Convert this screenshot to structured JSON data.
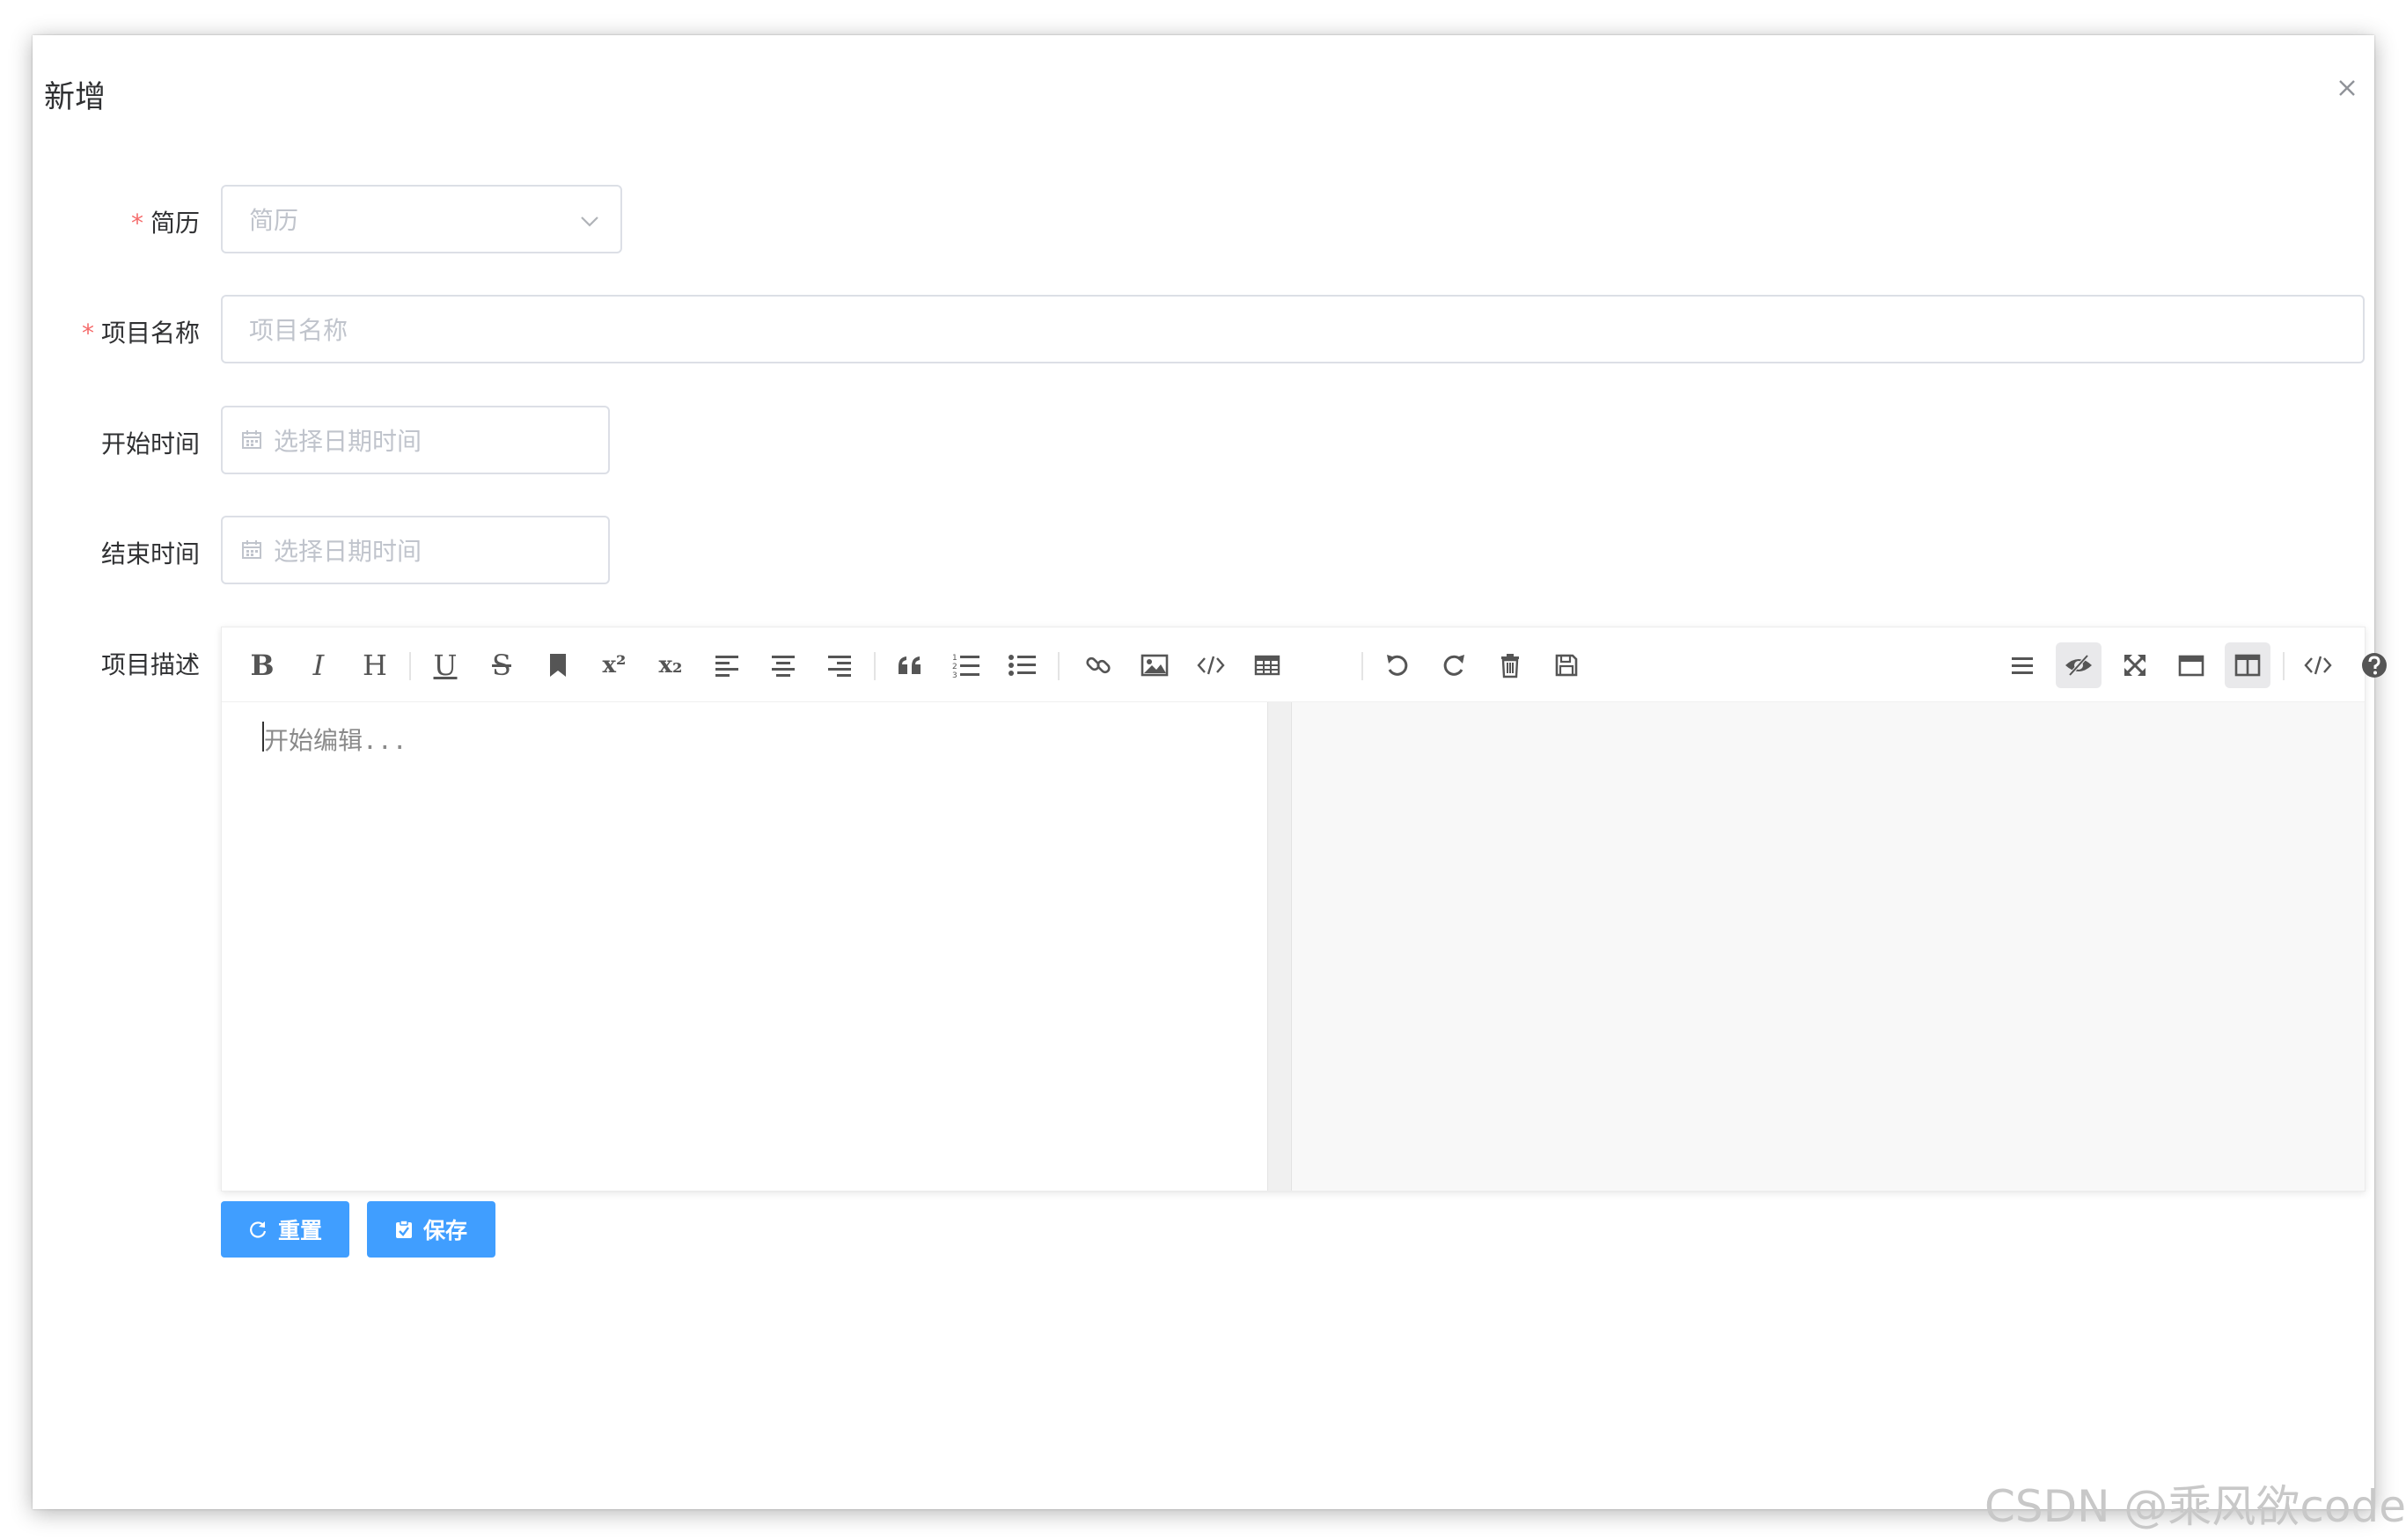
{
  "dialog": {
    "title": "新增",
    "close_icon": "close-icon"
  },
  "form": {
    "resume": {
      "required_mark": "*",
      "label": "简历",
      "placeholder": "简历"
    },
    "project_name": {
      "required_mark": "*",
      "label": "项目名称",
      "placeholder": "项目名称"
    },
    "start_time": {
      "label": "开始时间",
      "placeholder": "选择日期时间"
    },
    "end_time": {
      "label": "结束时间",
      "placeholder": "选择日期时间"
    },
    "description": {
      "label": "项目描述",
      "editor_placeholder": "开始编辑..."
    }
  },
  "toolbar": {
    "left": [
      {
        "icon": "bold-icon",
        "glyph": "B"
      },
      {
        "icon": "italic-icon",
        "glyph": "I"
      },
      {
        "icon": "heading-icon",
        "glyph": "H"
      },
      {
        "icon": "underline-icon",
        "glyph": "U"
      },
      {
        "icon": "strikethrough-icon",
        "glyph": "S"
      },
      {
        "icon": "bookmark-icon"
      },
      {
        "icon": "superscript-icon",
        "glyph": "x²"
      },
      {
        "icon": "subscript-icon",
        "glyph": "x₂"
      },
      {
        "icon": "align-left-icon"
      },
      {
        "icon": "align-center-icon"
      },
      {
        "icon": "align-right-icon"
      },
      {
        "icon": "quote-icon"
      },
      {
        "icon": "ordered-list-icon"
      },
      {
        "icon": "unordered-list-icon"
      },
      {
        "icon": "link-icon"
      },
      {
        "icon": "image-icon"
      },
      {
        "icon": "code-icon"
      },
      {
        "icon": "table-icon"
      },
      {
        "icon": "undo-icon"
      },
      {
        "icon": "redo-icon"
      },
      {
        "icon": "trash-icon"
      },
      {
        "icon": "save-icon"
      }
    ],
    "right": [
      {
        "icon": "navigation-icon"
      },
      {
        "icon": "preview-hidden-icon",
        "active": true
      },
      {
        "icon": "fullscreen-icon"
      },
      {
        "icon": "window-icon"
      },
      {
        "icon": "subfield-icon",
        "active": true
      },
      {
        "icon": "html-code-icon"
      },
      {
        "icon": "help-icon"
      }
    ]
  },
  "buttons": {
    "reset": {
      "label": "重置",
      "icon": "refresh-icon"
    },
    "save": {
      "label": "保存",
      "icon": "clipboard-check-icon"
    }
  },
  "colors": {
    "primary": "#409eff",
    "required": "#f56c6c"
  },
  "watermark": "CSDN @乘风欲code"
}
